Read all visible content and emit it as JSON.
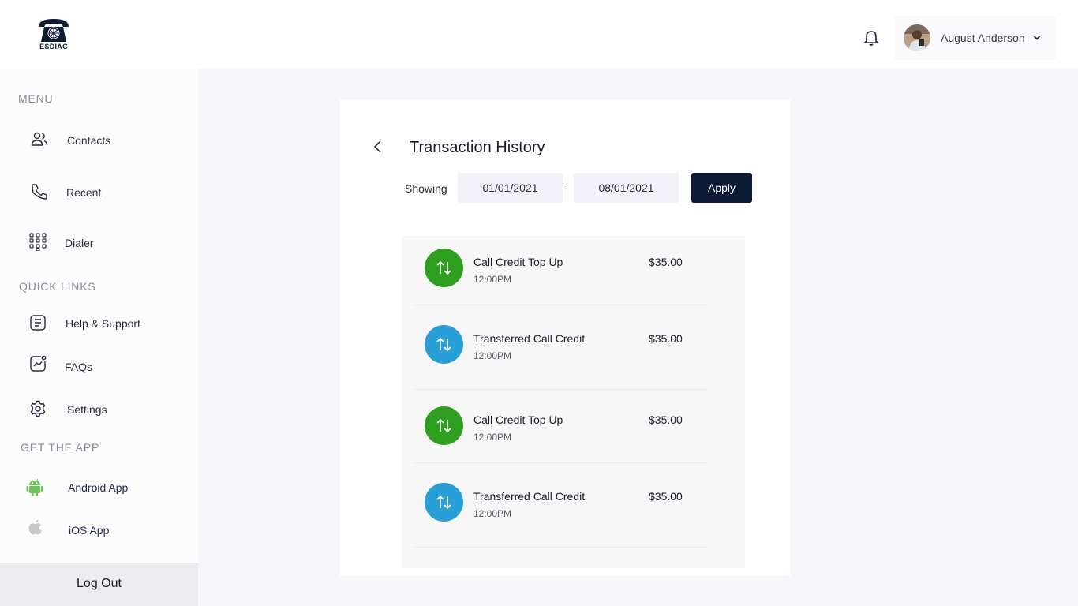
{
  "header": {
    "logo_text": "ESDIAC",
    "user_name": "August Anderson"
  },
  "sidebar": {
    "menu_title": "MENU",
    "menu_items": [
      {
        "label": "Contacts",
        "icon": "contacts-icon"
      },
      {
        "label": "Recent",
        "icon": "phone-icon"
      },
      {
        "label": "Dialer",
        "icon": "dialpad-icon"
      }
    ],
    "quick_links_title": "QUICK LINKS",
    "quick_links": [
      {
        "label": "Help & Support",
        "icon": "document-icon"
      },
      {
        "label": "FAQs",
        "icon": "chart-icon"
      },
      {
        "label": "Settings",
        "icon": "gear-icon"
      }
    ],
    "get_app_title": "GET THE APP",
    "apps": [
      {
        "label": "Android App",
        "icon": "android-icon"
      },
      {
        "label": "iOS App",
        "icon": "apple-icon"
      }
    ],
    "logout_label": "Log Out"
  },
  "main": {
    "title": "Transaction History",
    "showing_label": "Showing",
    "date_from": "01/01/2021",
    "date_to": "08/01/2021",
    "date_separator": "-",
    "apply_label": "Apply",
    "transactions": [
      {
        "title": "Call Credit Top Up",
        "time": "12:00PM",
        "amount": "$35.00",
        "color": "#2e9e1f"
      },
      {
        "title": "Transferred Call Credit",
        "time": "12:00PM",
        "amount": "$35.00",
        "color": "#2a9ed6"
      },
      {
        "title": "Call Credit Top Up",
        "time": "12:00PM",
        "amount": "$35.00",
        "color": "#2e9e1f"
      },
      {
        "title": "Transferred Call Credit",
        "time": "12:00PM",
        "amount": "$35.00",
        "color": "#2a9ed6"
      }
    ]
  },
  "colors": {
    "primary": "#0c1a36",
    "topup": "#2e9e1f",
    "transfer": "#2a9ed6",
    "android": "#6fc25a"
  }
}
